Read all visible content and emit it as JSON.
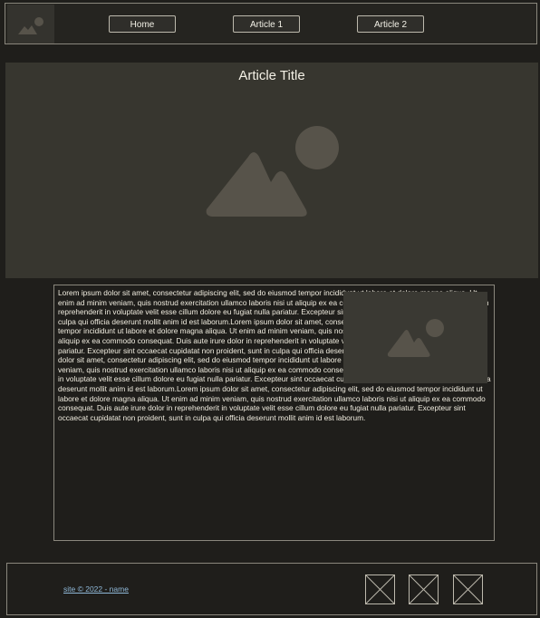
{
  "nav": {
    "items": [
      {
        "label": "Home"
      },
      {
        "label": "Article 1"
      },
      {
        "label": "Article 2"
      }
    ]
  },
  "hero": {
    "title": "Article Title",
    "image_icon": "image-placeholder-icon"
  },
  "article": {
    "body": "Lorem ipsum dolor sit amet, consectetur adipiscing elit, sed do eiusmod tempor incididunt ut labore et dolore magna aliqua. Ut enim ad minim veniam, quis nostrud exercitation ullamco laboris nisi ut aliquip ex ea commodo consequat. Duis aute irure dolor in reprehenderit in voluptate velit esse cillum dolore eu fugiat nulla pariatur. Excepteur sint occaecat cupidatat non proident, sunt in culpa qui officia deserunt mollit anim id est laborum.Lorem ipsum dolor sit amet, consectetur adipiscing elit, sed do eiusmod tempor incididunt ut labore et dolore magna aliqua. Ut enim ad minim veniam, quis nostrud exercitation ullamco laboris nisi ut aliquip ex ea commodo consequat. Duis aute irure dolor in reprehenderit in voluptate velit esse cillum dolore eu fugiat nulla pariatur. Excepteur sint occaecat cupidatat non proident, sunt in culpa qui officia deserunt mollit anim id est laborum.Lorem ipsum dolor sit amet, consectetur adipiscing elit, sed do eiusmod tempor incididunt ut labore et dolore magna aliqua. Ut enim ad minim veniam, quis nostrud exercitation ullamco laboris nisi ut aliquip ex ea commodo consequat. Duis aute irure dolor in reprehenderit in voluptate velit esse cillum dolore eu fugiat nulla pariatur. Excepteur sint occaecat cupidatat non proident, sunt in culpa qui officia deserunt mollit anim id est laborum.Lorem ipsum dolor sit amet, consectetur adipiscing elit, sed do eiusmod tempor incididunt ut labore et dolore magna aliqua. Ut enim ad minim veniam, quis nostrud exercitation ullamco laboris nisi ut aliquip ex ea commodo consequat. Duis aute irure dolor in reprehenderit in voluptate velit esse cillum dolore eu fugiat nulla pariatur. Excepteur sint occaecat cupidatat non proident, sunt in culpa qui officia deserunt mollit anim id est laborum.",
    "image_icon": "image-placeholder-icon"
  },
  "footer": {
    "copyright": "site © 2022 - name",
    "social_icons": [
      "social-placeholder-icon",
      "social-placeholder-icon",
      "social-placeholder-icon"
    ]
  },
  "colors": {
    "background": "#1f1e1b",
    "panel": "#37362f",
    "border": "#8a877d",
    "text": "#f1ede0",
    "link": "#8fb8d8",
    "placeholder_shape": "#57534a"
  }
}
